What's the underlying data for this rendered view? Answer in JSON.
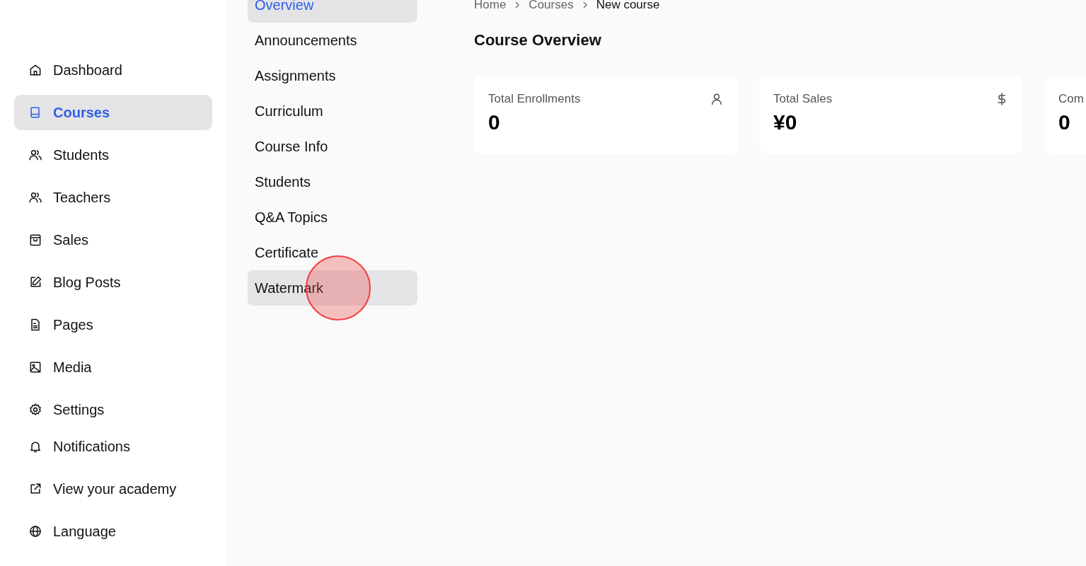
{
  "sidebar": {
    "items": [
      {
        "label": "Dashboard",
        "selected": false
      },
      {
        "label": "Courses",
        "selected": true
      },
      {
        "label": "Students",
        "selected": false
      },
      {
        "label": "Teachers",
        "selected": false
      },
      {
        "label": "Sales",
        "selected": false
      },
      {
        "label": "Blog Posts",
        "selected": false
      },
      {
        "label": "Pages",
        "selected": false
      },
      {
        "label": "Media",
        "selected": false
      },
      {
        "label": "Settings",
        "selected": false
      },
      {
        "label": "Notifications",
        "selected": false
      },
      {
        "label": "View your academy",
        "selected": false
      },
      {
        "label": "Language",
        "selected": false
      }
    ]
  },
  "course_menu": {
    "items": [
      {
        "label": "Overview",
        "selected": true,
        "hovered": false,
        "cursor_click": false
      },
      {
        "label": "Announcements",
        "selected": false,
        "hovered": false,
        "cursor_click": false
      },
      {
        "label": "Assignments",
        "selected": false,
        "hovered": false,
        "cursor_click": false
      },
      {
        "label": "Curriculum",
        "selected": false,
        "hovered": false,
        "cursor_click": false
      },
      {
        "label": "Course Info",
        "selected": false,
        "hovered": false,
        "cursor_click": false
      },
      {
        "label": "Students",
        "selected": false,
        "hovered": false,
        "cursor_click": false
      },
      {
        "label": "Q&A Topics",
        "selected": false,
        "hovered": false,
        "cursor_click": false
      },
      {
        "label": "Certificate",
        "selected": false,
        "hovered": false,
        "cursor_click": false
      },
      {
        "label": "Watermark",
        "selected": false,
        "hovered": true,
        "cursor_click": true
      }
    ]
  },
  "breadcrumb": [
    {
      "label": "Home",
      "current": false
    },
    {
      "label": "Courses",
      "current": false
    },
    {
      "label": "New course",
      "current": true
    }
  ],
  "title": "Course Overview",
  "stats": [
    {
      "label": "Total Enrollments",
      "value": "0"
    },
    {
      "label": "Total Sales",
      "value": "¥0"
    },
    {
      "label": "Com",
      "value": "0"
    }
  ]
}
